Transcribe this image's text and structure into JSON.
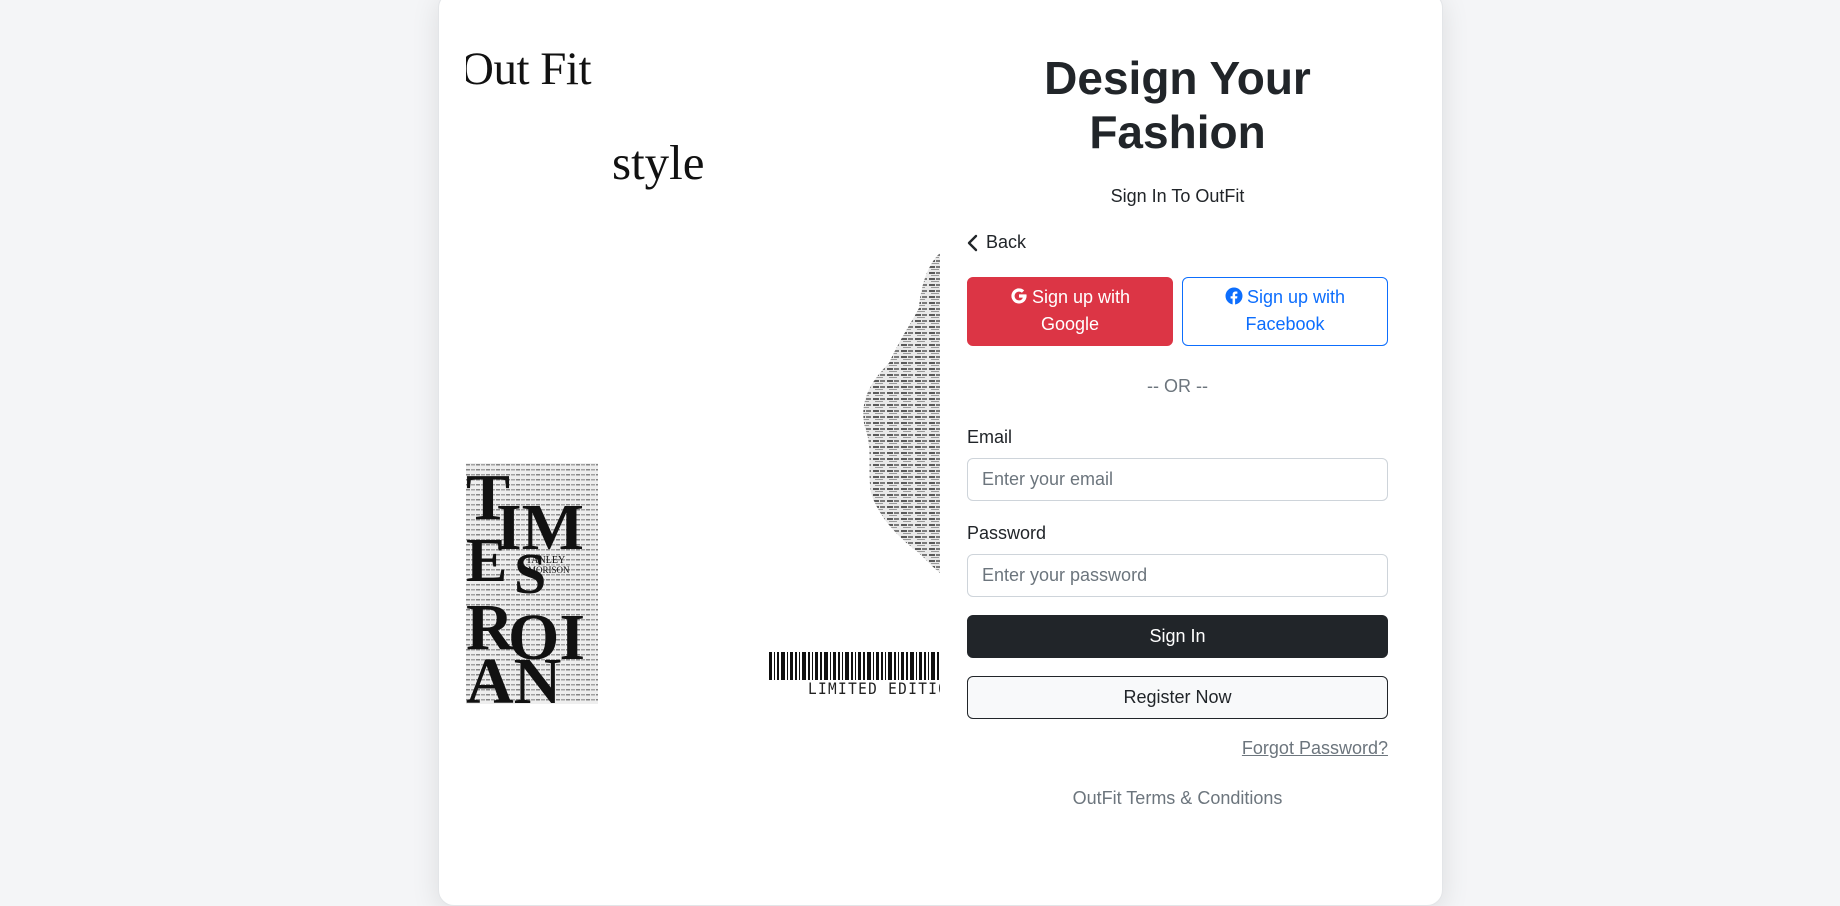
{
  "collage": {
    "outfit_text": "Out Fit",
    "style_text": "style",
    "edition_text": "LIMITED EDITIO"
  },
  "form": {
    "headline": "Design Your Fashion",
    "subtitle": "Sign In To OutFit",
    "back_label": "Back",
    "google_label": "Sign up with Google",
    "facebook_label": "Sign up with Facebook",
    "or_text": "-- OR --",
    "email_label": "Email",
    "email_placeholder": "Enter your email",
    "password_label": "Password",
    "password_placeholder": "Enter your password",
    "signin_label": "Sign In",
    "register_label": "Register Now",
    "forgot_label": "Forgot Password?",
    "terms_label": "OutFit Terms & Conditions"
  },
  "colors": {
    "google": "#dc3545",
    "facebook": "#0d6efd",
    "dark": "#212529",
    "muted": "#6c757d"
  },
  "icons": {
    "back": "chevron-left-icon",
    "google": "google-icon",
    "facebook": "facebook-icon"
  }
}
